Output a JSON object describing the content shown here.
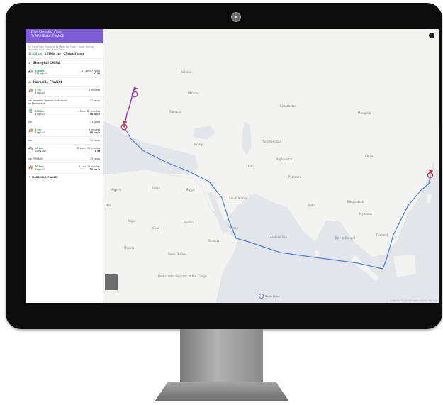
{
  "header": {
    "line1": "From Shanghai, China",
    "line2": "To MARSEILLE, FRANCE"
  },
  "intro": {
    "text": "Le Trajet from Shanghai to Marseille, from 2 ports: Sailing 3x/week, Every Port, Early Dates",
    "distance": "17,026 km",
    "emissions": "1,789 kg co2",
    "duration": "27 days 3 hours"
  },
  "ports": {
    "origin": "Shanghai CHINA",
    "transit": "Marseille FRANCE",
    "destination": "MARSEILLE, FRANCE"
  },
  "legs": [
    {
      "distance": "898 km",
      "co2": "234 kg co2",
      "time": "11 days 7 hours",
      "speed": "22 kt"
    },
    {
      "distance": "7 km",
      "co2": "1 kg co2",
      "time": "8 minutes",
      "speed": ""
    },
    {
      "distance": "258 km",
      "co2": "3 kg co2",
      "time": "4 hours 37 minutes",
      "speed": "38 km/h"
    },
    {
      "distance": "8 km",
      "co2": "2 kg co2",
      "time": "9 minutes",
      "speed": "38 km/h"
    },
    {
      "distance": "23 km",
      "co2": "15 kg co2",
      "time": "28 hours 39 minutes",
      "speed": "8 kt"
    },
    {
      "distance": "90 km",
      "co2": "3 kg co2",
      "time": "1 hour 18 minutes",
      "speed": "38 km/h"
    }
  ],
  "stops": [
    {
      "label": "via Marseille, Terminal multimodal",
      "time": "12 hours",
      "sub": "de Mourepiane"
    },
    {
      "label": "via",
      "time": "13 hours"
    },
    {
      "label": "via",
      "time": "13 hours"
    },
    {
      "label": "via ZI MIAUS",
      "time": "13 hours"
    }
  ],
  "map": {
    "labels": {
      "belarus": "Belarus",
      "ukraine": "Ukraine",
      "romania": "Romania",
      "kazakhstan": "Kazakhstan",
      "turkmenistan": "Turkmenistan",
      "turkey": "Turkey",
      "iran": "Iran",
      "afghanistan": "Afghanistan",
      "algeria": "Algeria",
      "libya": "Libya",
      "egypt": "Egypt",
      "saudi_arabia": "Saudi Arabia",
      "pakistan": "Pakistan",
      "india": "India",
      "china": "China",
      "mongolia": "Mongolia",
      "bangladesh": "Bangladesh",
      "myanmar": "Myanmar",
      "thailand": "Thailand",
      "niger": "Niger",
      "chad": "Chad",
      "sudan": "Sudan",
      "nigeria": "Nigeria",
      "ethiopia": "Ethiopia",
      "south_sudan": "South Sudan",
      "congo": "Democratic Republic of the Congo",
      "arabian_sea": "Arabian Sea",
      "bay_of_bengal": "Bay of Bengal",
      "mali": "Mali",
      "yemen": "Yemen"
    },
    "legend": "Route Lines",
    "attribution": "© Mapbox © OpenStreetMap Improve this map",
    "colors": {
      "sea_route": "#4a7fd4",
      "land_route": "#9c3fb5",
      "marker": "#c0304a",
      "land": "#f3f3f1",
      "water": "#e2e6ea"
    }
  }
}
